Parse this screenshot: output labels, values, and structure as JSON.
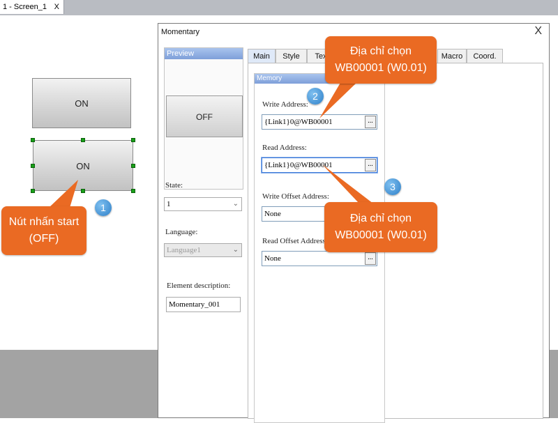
{
  "window": {
    "tab_title": "1 - Screen_1",
    "tab_close": "X"
  },
  "canvas": {
    "button_top_label": "ON",
    "button_selected_label": "ON"
  },
  "dialog": {
    "title": "Momentary",
    "close": "X",
    "preview": {
      "header": "Preview",
      "button_label": "OFF"
    },
    "state": {
      "label": "State:",
      "value": "1"
    },
    "language": {
      "label": "Language:",
      "value": "Language1"
    },
    "description": {
      "label": "Element description:",
      "value": "Momentary_001"
    },
    "tabs": [
      "Main",
      "Style",
      "Tex",
      "Macro",
      "Coord."
    ],
    "memory": {
      "header": "Memory",
      "write_label": "Write Address:",
      "write_value": "{Link1}0@WB00001",
      "read_label": "Read Address:",
      "read_value": "{Link1}0@WB00001",
      "write_offset_label": "Write Offset Address:",
      "write_offset_value": "None",
      "read_offset_label": "Read Offset Address:",
      "read_offset_value": "None",
      "browse": "..."
    }
  },
  "annotations": {
    "callout_start": "Nút nhấn start (OFF)",
    "callout_write": "Địa chỉ chọn WB00001 (W0.01)",
    "callout_read": "Địa chỉ chọn WB00001 (W0.01)",
    "badge1": "1",
    "badge2": "2",
    "badge3": "3"
  },
  "colors": {
    "callout": "#ea6a23",
    "badge": "#2d7fc8",
    "selection_handle": "#18a018"
  }
}
